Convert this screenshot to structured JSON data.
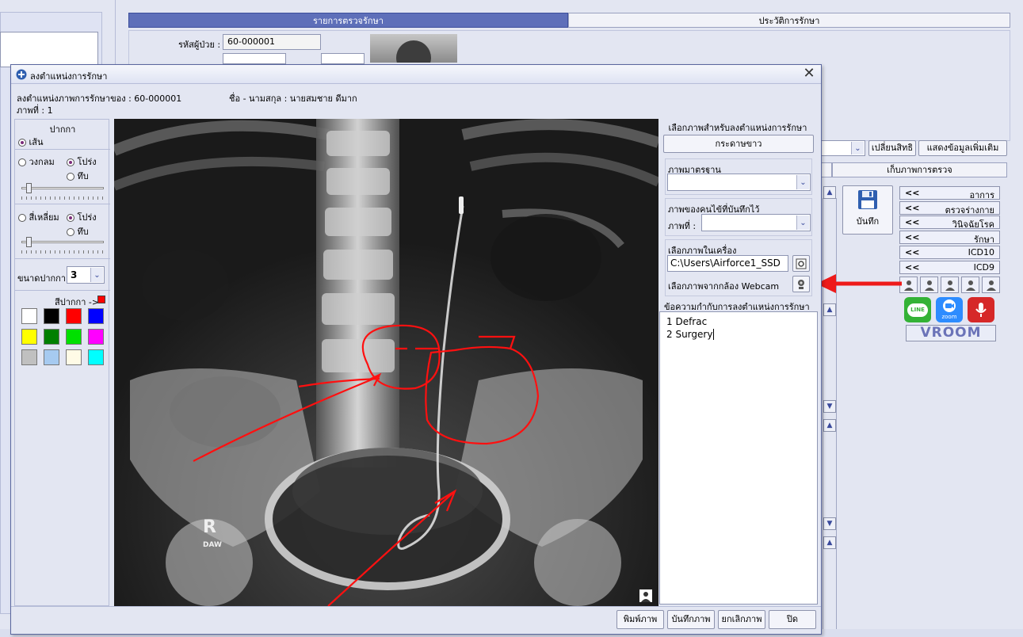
{
  "background": {
    "tabs": [
      "รายการตรวจรักษา",
      "ประวัติการรักษา"
    ],
    "patient_id_label": "รหัสผู้ป่วย :",
    "patient_id_value": "60-000001",
    "change_rights_label": "เปลี่ยนสิทธิ",
    "more_info_label": "แสดงข้อมูลเพิ่มเติม",
    "keep_images_tab": "เก็บภาพการตรวจ",
    "save_label": "บันทึก",
    "right_panel_items": [
      {
        "arrow": "<<",
        "label": "อาการ"
      },
      {
        "arrow": "<<",
        "label": "ตรวจร่างกาย"
      },
      {
        "arrow": "<<",
        "label": "วินิจฉัยโรค"
      },
      {
        "arrow": "<<",
        "label": "รักษา"
      },
      {
        "arrow": "<<",
        "label": "ICD10"
      },
      {
        "arrow": "<<",
        "label": "ICD9"
      }
    ],
    "apps": {
      "line": "LINE",
      "zoom": "zoom",
      "vroom": "VROOM"
    }
  },
  "dialog": {
    "title": "ลงตำแหน่งการรักษา",
    "header_line1": "ลงตำแหน่งภาพการรักษาของ : 60-000001",
    "header_name": "ชื่อ - นามสกุล : นายสมชาย ดีมาก",
    "header_line2": "ภาพที่ : 1",
    "left": {
      "pen_title": "ปากกา",
      "line_label": "เส้น",
      "circle_label": "วงกลม",
      "transparent_label": "โปร่ง",
      "solid_label": "ทึบ",
      "rect_label": "สี่เหลี่ยม",
      "pen_size_label": "ขนาดปากกา",
      "pen_size_value": "3",
      "pen_color_label": "สีปากกา ->",
      "current_color": "#ff0000",
      "palette": [
        "#ffffff",
        "#000000",
        "#ff0000",
        "#0000ff",
        "#ffff00",
        "#008000",
        "#00e000",
        "#ff00ff",
        "#c0c0c0",
        "#a6caf0",
        "#fffbe6",
        "#00ffff"
      ]
    },
    "xray": {
      "marker_text": "R",
      "marker_sub": "DAW"
    },
    "right": {
      "select_title": "เลือกภาพสำหรับลงตำแหน่งการรักษา",
      "white_paper_button": "กระดาษขาว",
      "standard_image_label": "ภาพมาตรฐาน",
      "patient_saved_label": "ภาพของคนไข้ที่บันทึกไว้",
      "image_no_label": "ภาพที่ :",
      "local_image_label": "เลือกภาพในเครื่อง",
      "local_path_value": "C:\\Users\\Airforce1_SSD",
      "webcam_label": "เลือกภาพจากกล้อง Webcam",
      "notes_label": "ข้อความกำกับการลงตำแหน่งการรักษา",
      "notes_lines": [
        "1 Defrac",
        "2 Surgery"
      ]
    },
    "buttons": {
      "print": "พิมพ์ภาพ",
      "save": "บันทึกภาพ",
      "cancel": "ยกเลิกภาพ",
      "close": "ปิด"
    }
  }
}
